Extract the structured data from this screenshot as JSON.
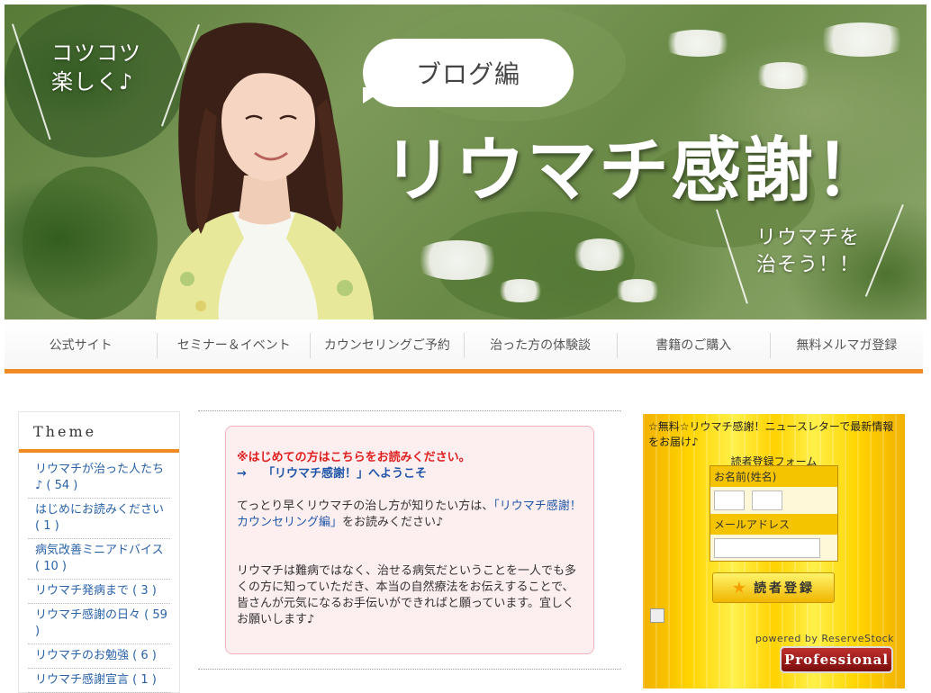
{
  "banner": {
    "tagline_left": "コツコツ\n楽しく♪",
    "bubble": "ブログ編",
    "title": "リウマチ感謝！",
    "tagline_right": "リウマチを\n治そう！！"
  },
  "nav": {
    "items": [
      {
        "label": "公式サイト"
      },
      {
        "label": "セミナー＆イベント"
      },
      {
        "label": "カウンセリングご予約"
      },
      {
        "label": "治った方の体験談"
      },
      {
        "label": "書籍のご購入"
      },
      {
        "label": "無料メルマガ登録"
      }
    ]
  },
  "theme": {
    "heading": "Theme",
    "items": [
      {
        "label": "リウマチが治った人たち♪ ( 54 )"
      },
      {
        "label": "はじめにお読みください ( 1 )"
      },
      {
        "label": "病気改善ミニアドバイス ( 10 )"
      },
      {
        "label": "リウマチ発病まで ( 3 )"
      },
      {
        "label": "リウマチ感謝の日々 ( 59 )"
      },
      {
        "label": "リウマチのお勉強 ( 6 )"
      },
      {
        "label": "リウマチ感謝宣言 ( 1 )"
      }
    ]
  },
  "welcome": {
    "notice": "※はじめての方はこちらをお読みください。",
    "arrow": "→",
    "welcome_link": "「リウマチ感謝！」へようこそ",
    "para1_pre": "てっとり早くリウマチの治し方が知りたい方は、",
    "para1_link": "「リウマチ感謝！カウンセリング編」",
    "para1_post": "をお読みください♪",
    "para2": "リウマチは難病ではなく、治せる病気だということを一人でも多くの方に知っていただき、本当の自然療法をお伝えすることで、皆さんが元気になるお手伝いができればと願っています。宜しくお願いします♪"
  },
  "newsletter": {
    "header": "☆無料☆リウマチ感謝！ニュースレターで最新情報をお届け♪",
    "subheader": "読者登録フォーム",
    "name_label": "お名前(姓名)",
    "email_label": "メールアドレス",
    "submit_label": "読者登録",
    "powered": "powered by ReserveStock",
    "badge": "Professional"
  },
  "colors": {
    "accent": "#f08a22",
    "link": "#2a62a8",
    "notice_red": "#e02020"
  }
}
